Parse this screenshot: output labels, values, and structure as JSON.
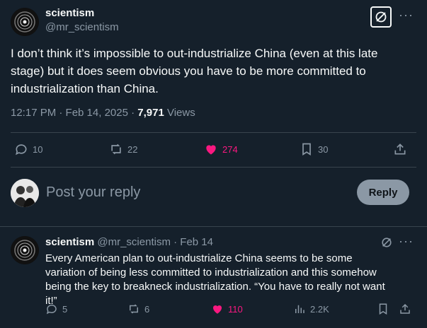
{
  "main_post": {
    "display_name": "scientism",
    "handle": "@mr_scientism",
    "text": "I don’t think it’s impossible to out-industrialize China (even at this late stage) but it does seem obvious you have to be more committed to industrialization than China.",
    "timestamp": "12:17 PM · Feb 14, 2025 · ",
    "views_count": "7,971",
    "views_label": " Views",
    "actions": {
      "replies": "10",
      "reposts": "22",
      "likes": "274",
      "bookmarks": "30"
    }
  },
  "reply_composer": {
    "placeholder": "Post your reply",
    "button_label": "Reply"
  },
  "reply_post": {
    "display_name": "scientism",
    "handle": "@mr_scientism",
    "date": " · Feb 14",
    "text": "Every American plan to out-industrialize China seems to be some variation of being less committed to industrialization and this somehow being the key to breakneck industrialization. “You have to really not want it!”",
    "actions": {
      "replies": "5",
      "reposts": "6",
      "likes": "110",
      "views": "2.2K"
    }
  },
  "colors": {
    "background": "#15202b",
    "like_active": "#f91880",
    "muted_text": "#8b98a5"
  }
}
